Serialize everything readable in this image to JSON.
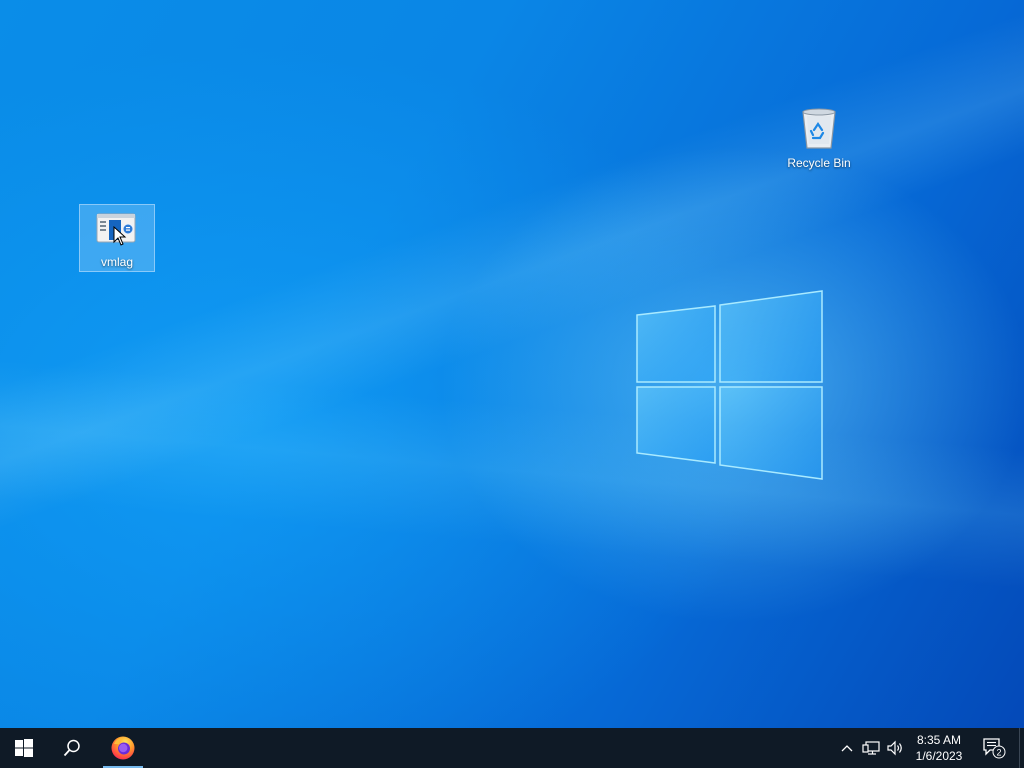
{
  "desktop": {
    "icons": [
      {
        "label": "vmlag",
        "icon": "vmlag-app-icon",
        "selected": true
      },
      {
        "label": "Recycle Bin",
        "icon": "recycle-bin-icon",
        "selected": false
      }
    ]
  },
  "taskbar": {
    "start_icon": "windows-start-icon",
    "search_icon": "search-icon",
    "pinned": [
      {
        "name": "Firefox",
        "icon": "firefox-icon",
        "active": true
      }
    ],
    "tray": {
      "chevron_icon": "chevron-up-icon",
      "network_icon": "network-icon",
      "volume_icon": "volume-icon"
    },
    "clock": {
      "time": "8:35 AM",
      "date": "1/6/2023"
    },
    "notifications": {
      "icon": "action-center-icon",
      "count": "2"
    }
  },
  "colors": {
    "accent": "#0078d7",
    "taskbar": "#0f1a26",
    "active_indicator": "#76b9ed"
  }
}
